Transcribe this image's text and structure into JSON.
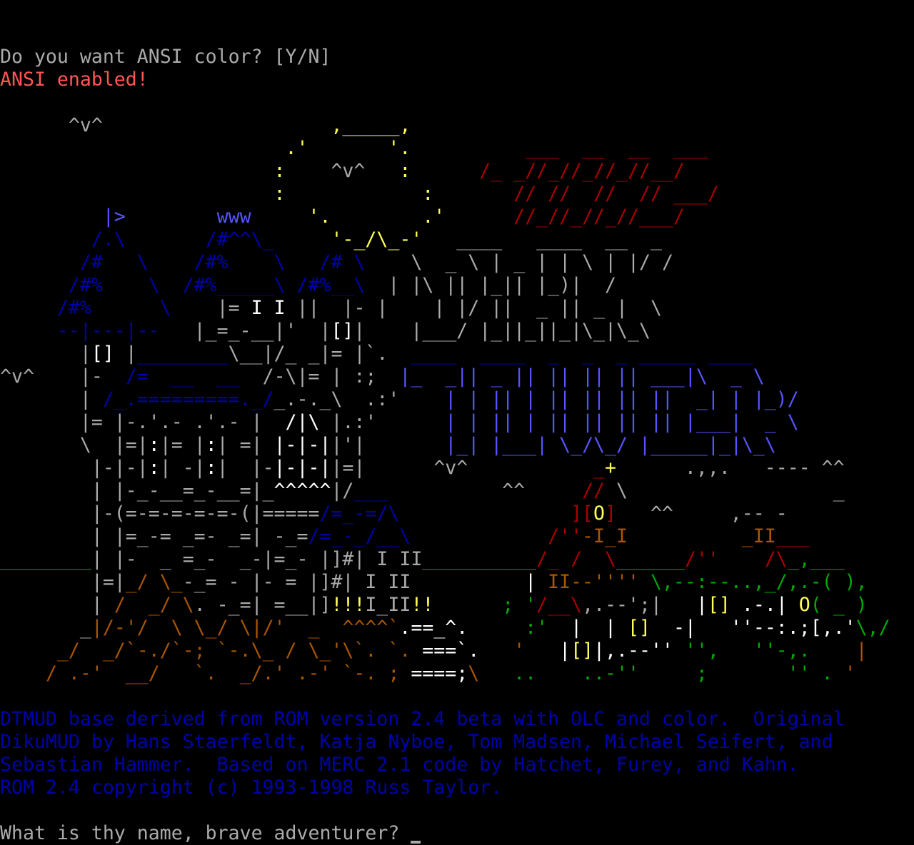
{
  "colors": {
    "background": "#000000",
    "gray": "#aaaaaa",
    "white": "#ffffff",
    "light_red": "#ff5555",
    "red": "#aa0000",
    "yellow": "#ffff55",
    "blue": "#0000aa",
    "light_blue": "#5555ff",
    "green": "#00aa00",
    "brown": "#aa5500"
  },
  "terminal": {
    "prompt_ansi": "Do you want ANSI color? [Y/N]",
    "ansi_enabled": "ANSI enabled!",
    "credits": [
      "DTMUD base derived from ROM version 2.4 beta with OLC and color.  Original",
      "DikuMUD by Hans Staerfeldt, Katja Nyboe, Tom Madsen, Michael Seifert, and",
      "Sebastian Hammer.  Based on MERC 2.1 code by Hatchet, Furey, and Kahn.",
      "ROM 2.4 copyright (c) 1993-1998 Russ Taylor."
    ],
    "name_prompt": "What is thy name, brave adventurer?",
    "banner_art": [
      [
        [
          "      ^v^",
          "gray"
        ],
        [
          "                    ,_____,",
          "yellow"
        ]
      ],
      [
        [
          "                         .'",
          "yellow"
        ],
        [
          "       '.",
          "yellow"
        ],
        [
          "          ___  __  __  ___",
          "red"
        ]
      ],
      [
        [
          "                        :  ",
          "yellow"
        ],
        [
          "  ^v^ ",
          "gray"
        ],
        [
          "  :",
          "yellow"
        ],
        [
          "      /_ _//_//_//_//__/",
          "red"
        ]
      ],
      [
        [
          "                        :",
          "yellow"
        ],
        [
          "            :",
          "yellow"
        ],
        [
          "       // //  //  // ___/",
          "red"
        ]
      ],
      [
        [
          "         ",
          "gray"
        ],
        [
          "|>",
          "light_blue"
        ],
        [
          "        ",
          "gray"
        ],
        [
          "www",
          "light_blue"
        ],
        [
          "     ",
          "gray"
        ],
        [
          "'.",
          "yellow"
        ],
        [
          "        .'",
          "yellow"
        ],
        [
          "      //_//_//_//___/",
          "red"
        ]
      ],
      [
        [
          "        ",
          "gray"
        ],
        [
          "/.\\",
          "blue"
        ],
        [
          "       ",
          "gray"
        ],
        [
          "/#^^\\_",
          "blue"
        ],
        [
          "     ",
          "gray"
        ],
        [
          "'-_/\\_-'",
          "yellow"
        ],
        [
          "   ____   ____  __  _",
          "gray"
        ]
      ],
      [
        [
          "       ",
          "gray"
        ],
        [
          "/#   \\",
          "blue"
        ],
        [
          "    ",
          "gray"
        ],
        [
          "/#%    \\",
          "blue"
        ],
        [
          "   ",
          "gray"
        ],
        [
          "/# \\",
          "blue"
        ],
        [
          "    ",
          "gray"
        ],
        [
          "\\  _ \\ | _ | | \\ | |/ /",
          "gray"
        ]
      ],
      [
        [
          "      ",
          "gray"
        ],
        [
          "/#%    \\",
          "blue"
        ],
        [
          "  ",
          "gray"
        ],
        [
          "/#%_____\\",
          "blue"
        ],
        [
          " ",
          "gray"
        ],
        [
          "/#%__\\",
          "blue"
        ],
        [
          "  ",
          "gray"
        ],
        [
          "| |\\ || |_|| |_)|  /",
          "gray"
        ]
      ],
      [
        [
          "     ",
          "gray"
        ],
        [
          "/#%",
          "blue"
        ],
        [
          "      ",
          "gray"
        ],
        [
          "\\",
          "blue"
        ],
        [
          "    |= ",
          "gray"
        ],
        [
          "I I",
          "white"
        ],
        [
          " ||  |- |",
          "gray"
        ],
        [
          "    ",
          "gray"
        ],
        [
          "| |/ ||  _ || _ |  \\",
          "gray"
        ]
      ],
      [
        [
          "     ",
          "gray"
        ],
        [
          "--|---|--",
          "blue"
        ],
        [
          "   |_=_-__|'  |",
          "gray"
        ],
        [
          "[]",
          "white"
        ],
        [
          "|",
          "gray"
        ],
        [
          "    ",
          "gray"
        ],
        [
          "|___/ |_||_||_|\\_|\\_\\",
          "gray"
        ]
      ],
      [
        [
          "       |",
          "gray"
        ],
        [
          "[]",
          "white"
        ],
        [
          " |",
          "gray"
        ],
        [
          "________",
          "blue"
        ],
        [
          "\\__|/_ _|= |`.",
          "gray"
        ],
        [
          "  ",
          "gray"
        ],
        [
          "____  ____  _  _  _ _____ ____",
          "blue"
        ]
      ],
      [
        [
          "^v^",
          "gray"
        ],
        [
          "    |-  ",
          "gray"
        ],
        [
          "/=  __  __",
          "blue"
        ],
        [
          "  /-\\|= | :;",
          "gray"
        ],
        [
          "  ",
          "gray"
        ],
        [
          "|_  _|| _ || || || || ___|\\  _ \\",
          "light_blue"
        ]
      ],
      [
        [
          "       | ",
          "gray"
        ],
        [
          "/_.=========._/",
          "blue"
        ],
        [
          "_.-._\\",
          "gray"
        ],
        [
          "  .:'",
          "gray"
        ],
        [
          "   ",
          "gray"
        ],
        [
          " | | || | || || || ||  _| | |_)/",
          "light_blue"
        ]
      ],
      [
        [
          "       |= |-.'.- .'.- |  ",
          "gray"
        ],
        [
          "/|\\",
          "white"
        ],
        [
          " |.:'",
          "gray"
        ],
        [
          "     ",
          "gray"
        ],
        [
          " | | || | || || || || |___|  _ \\",
          "light_blue"
        ]
      ],
      [
        [
          "       \\  |=|",
          "gray"
        ],
        [
          ":",
          "white"
        ],
        [
          "|= |",
          "gray"
        ],
        [
          ":",
          "white"
        ],
        [
          "| =| ",
          "gray"
        ],
        [
          "|-|-|",
          "white"
        ],
        [
          "|'|",
          "gray"
        ],
        [
          "       ",
          "gray"
        ],
        [
          "|_| |___| \\_/\\_/ |_____|_|\\_\\",
          "light_blue"
        ]
      ],
      [
        [
          "        |-|-|",
          "gray"
        ],
        [
          ":",
          "white"
        ],
        [
          "| -|",
          "gray"
        ],
        [
          ":",
          "white"
        ],
        [
          "|  |-",
          "gray"
        ],
        [
          "|-|-|",
          "white"
        ],
        [
          "|=|",
          "gray"
        ],
        [
          "      ^v^",
          "gray"
        ],
        [
          "           ",
          "gray"
        ],
        [
          "_",
          "red"
        ],
        [
          "+",
          "yellow"
        ],
        [
          "      .,,.   ---- ^^",
          "gray"
        ]
      ],
      [
        [
          "        | |-_-__=_-__=|_",
          "gray"
        ],
        [
          "^^^^^",
          "white"
        ],
        [
          "|/",
          "gray"
        ],
        [
          "___",
          "blue"
        ],
        [
          "          ^^     ",
          "gray"
        ],
        [
          "//",
          "red"
        ],
        [
          " \\",
          "gray"
        ],
        [
          "                  _",
          "gray"
        ]
      ],
      [
        [
          "        |-(=-=-=-=-=-(|=====",
          "gray"
        ],
        [
          "/=_-=/\\",
          "blue"
        ],
        [
          "               ",
          "gray"
        ],
        [
          "][",
          "red"
        ],
        [
          "O",
          "yellow"
        ],
        [
          "]",
          "red"
        ],
        [
          "   ^^     ,-- -",
          "gray"
        ]
      ],
      [
        [
          "        | |=_-= _=- _=| -_=",
          "gray"
        ],
        [
          "/=_-_/__\\",
          "blue"
        ],
        [
          "            ",
          "gray"
        ],
        [
          "/''",
          "red"
        ],
        [
          "-I_I",
          "brown"
        ],
        [
          "          ",
          "gray"
        ],
        [
          "_II",
          "brown"
        ],
        [
          "___",
          "red"
        ]
      ],
      [
        [
          "",
          "gray"
        ],
        [
          "________",
          "green"
        ],
        [
          "| |-  _ =_-  _-|=_- |]#| I II",
          "gray"
        ],
        [
          "__________",
          "green"
        ],
        [
          "/_",
          "red"
        ],
        [
          " /  ",
          "red"
        ],
        [
          "\\",
          "red"
        ],
        [
          "______",
          "green"
        ],
        [
          "/''    ",
          "red"
        ],
        [
          "/\\",
          "red"
        ],
        [
          "_,___",
          "green"
        ]
      ],
      [
        [
          "        |=|",
          "gray"
        ],
        [
          "_/ \\_",
          "brown"
        ],
        [
          "-_= - |- = |]#| I II",
          "gray"
        ],
        [
          "          ",
          "gray"
        ],
        [
          "| ",
          "white"
        ],
        [
          "II--''''",
          "brown"
        ],
        [
          " \\,--:--..,_/,.-( ),",
          "green"
        ]
      ],
      [
        [
          "        | ",
          "gray"
        ],
        [
          "/  _/ \\",
          "brown"
        ],
        [
          ". -_=| =__|]",
          "gray"
        ],
        [
          "!!!",
          "yellow"
        ],
        [
          "I_II",
          "gray"
        ],
        [
          "!!",
          "yellow"
        ],
        [
          "      ",
          "gray"
        ],
        [
          "; '",
          "green"
        ],
        [
          "/__\\",
          "red"
        ],
        [
          ",.--';|",
          "gray"
        ],
        [
          "   ",
          "gray"
        ],
        [
          "|",
          "white"
        ],
        [
          "[]",
          "yellow"
        ],
        [
          " .-.| ",
          "white"
        ],
        [
          "O",
          "yellow"
        ],
        [
          "( _ )",
          "green"
        ]
      ],
      [
        [
          "       _",
          "gray"
        ],
        [
          "|/-'/  \\ \\_/ \\|/'",
          "brown"
        ],
        [
          "  ",
          "gray"
        ],
        [
          "_",
          "brown"
        ],
        [
          "  ",
          "gray"
        ],
        [
          "^^^^`",
          "brown"
        ],
        [
          ".==_^.",
          "white"
        ],
        [
          "     ",
          "gray"
        ],
        [
          ":'",
          "green"
        ],
        [
          "  |  | ",
          "white"
        ],
        [
          "[]",
          "yellow"
        ],
        [
          "  -|",
          "white"
        ],
        [
          "   ",
          "gray"
        ],
        [
          "''--:.;[,.'",
          "white"
        ],
        [
          "\\,/",
          "green"
        ]
      ],
      [
        [
          "     ",
          "gray"
        ],
        [
          "_/  _/`-./`-; `-.\\_ / \\_'\\`. `. ",
          "brown"
        ],
        [
          "===`.",
          "white"
        ],
        [
          "   ",
          "gray"
        ],
        [
          "'",
          "brown"
        ],
        [
          "   |",
          "white"
        ],
        [
          "[]",
          "yellow"
        ],
        [
          "|,.--''",
          "white"
        ],
        [
          " '',",
          "green"
        ],
        [
          "   ",
          "gray"
        ],
        [
          "''-,.",
          "green"
        ],
        [
          "    ",
          "gray"
        ],
        [
          "|",
          "brown"
        ]
      ],
      [
        [
          "    ",
          "gray"
        ],
        [
          "/ .-'  __/   `.  _/.' .-' `-. ; ",
          "brown"
        ],
        [
          "====;",
          "white"
        ],
        [
          "\\",
          "brown"
        ],
        [
          "  ",
          "gray"
        ],
        [
          " ..    ..-''     ;       '' .",
          "green"
        ],
        [
          " '",
          "brown"
        ]
      ]
    ]
  }
}
